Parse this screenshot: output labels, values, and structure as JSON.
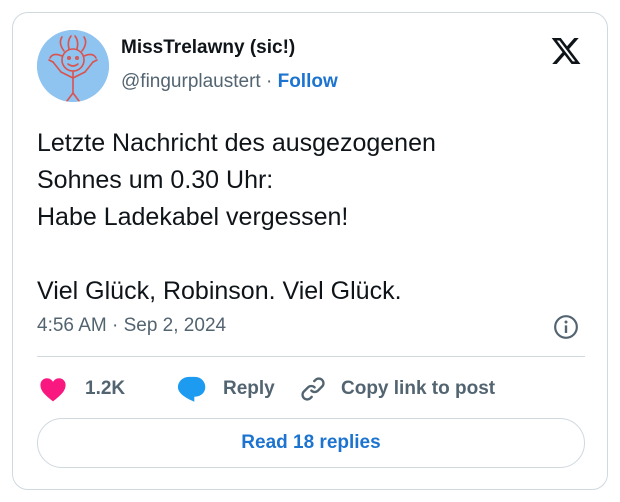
{
  "author": {
    "name": "MissTrelawny (sic!)",
    "handle": "@fingurplaustert",
    "separator": "·",
    "follow_label": "Follow"
  },
  "tweet": {
    "lines": [
      "Letzte Nachricht des ausgezogenen",
      "Sohnes um 0.30 Uhr:",
      "Habe Ladekabel vergessen!",
      "",
      "Viel Glück, Robinson. Viel Glück."
    ],
    "timestamp": "4:56 AM · Sep 2, 2024"
  },
  "actions": {
    "like_count": "1.2K",
    "reply_label": "Reply",
    "copy_link_label": "Copy link to post"
  },
  "read_replies_label": "Read 18 replies",
  "icons": {
    "logo": "x-logo-icon",
    "info": "info-icon",
    "like": "heart-icon",
    "reply": "speech-bubble-icon",
    "copy": "link-icon"
  },
  "colors": {
    "link": "#1d74d0",
    "heart": "#f91880",
    "reply_bubble": "#1d9bf0",
    "text_primary": "#0f1419",
    "text_secondary": "#536471",
    "border": "#cfd9de",
    "avatar_bg": "#8fc3f0"
  }
}
